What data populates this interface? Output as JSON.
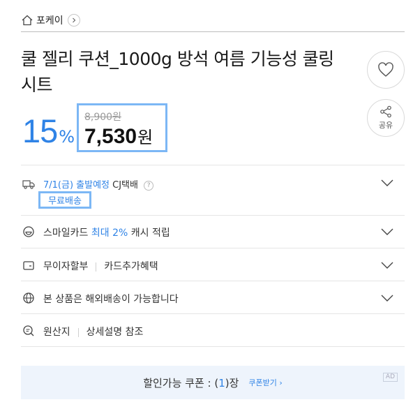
{
  "store": {
    "name": "포케이",
    "home_icon": "home-icon",
    "link_icon": "chevron-right-icon"
  },
  "product": {
    "title": "쿨 젤리 쿠션_1000g 방석 여름 기능성 쿨링 시트"
  },
  "actions": {
    "share_label": "공유"
  },
  "price": {
    "discount_number": "15",
    "discount_sign": "%",
    "original": "8,900원",
    "final_number": "7,530",
    "final_unit": "원"
  },
  "delivery": {
    "date": "7/1(금) 출발예정",
    "carrier": "CJ택배",
    "help": "?",
    "shipping_fee": "무료배송"
  },
  "smilecard": {
    "label": "스마일카드",
    "highlight": "최대 2%",
    "suffix": "캐시 적립"
  },
  "installment": {
    "label": "무이자할부",
    "benefit": "카드추가혜택"
  },
  "global": {
    "label": "본 상품은 해외배송이 가능합니다"
  },
  "origin": {
    "label": "원산지",
    "value": "상세설명 참조"
  },
  "coupon": {
    "label_prefix": "할인가능 쿠폰 : (",
    "count": "1",
    "label_suffix": ")장",
    "link": "쿠폰받기 ›",
    "ad": "AD"
  },
  "colors": {
    "accent": "#2f83e6",
    "highlight_border": "#7cb7f5",
    "coupon_bg": "#eef4fc"
  }
}
